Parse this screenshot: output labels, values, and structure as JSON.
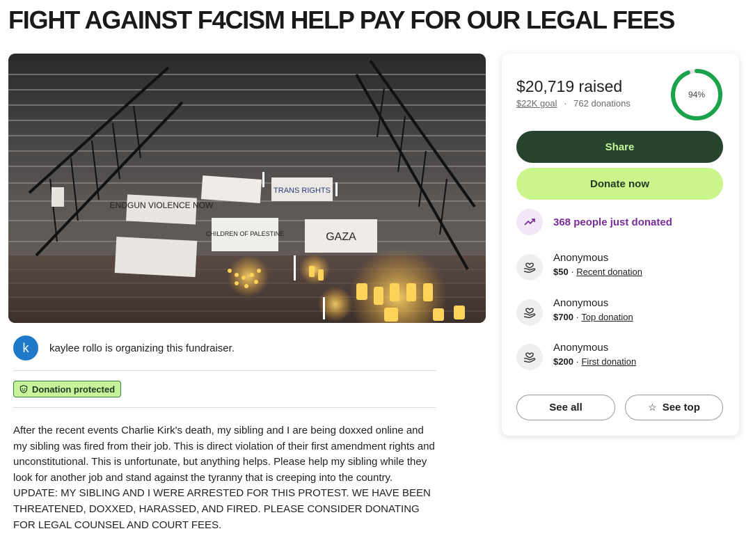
{
  "page": {
    "title": "FIGHT AGAINST F4CISM HELP PAY FOR OUR LEGAL FEES"
  },
  "photo": {
    "signs": [
      "ENDGUN VIOLENCE NOW",
      "TRANS RIGHTS",
      "CHILDREN OF PALESTINE",
      "GAZA"
    ]
  },
  "organizer": {
    "avatar_letter": "k",
    "text": "kaylee rollo is organizing this fundraiser."
  },
  "badge": {
    "label": "Donation protected"
  },
  "story": {
    "text": "After the recent events Charlie Kirk's death, my sibling and I are being doxxed online and my sibling was fired from their job. This is direct violation of their first amendment rights and unconstitutional. This is unfortunate, but anything helps. Please help my sibling while they look for another job and stand against the tyranny that is creeping into the country. UPDATE: MY SIBLING AND I WERE ARRESTED FOR THIS PROTEST. WE HAVE BEEN THREATENED, DOXXED, HARASSED, AND FIRED. PLEASE CONSIDER DONATING FOR LEGAL COUNSEL AND COURT FEES."
  },
  "donation_card": {
    "raised": "$20,719 raised",
    "goal": "$22K goal",
    "separator": "·",
    "donations_count": "762 donations",
    "progress_label": "94%",
    "progress_fraction": 0.94,
    "share_label": "Share",
    "donate_label": "Donate now",
    "just_donated": "368 people just donated",
    "donors": [
      {
        "name": "Anonymous",
        "amount": "$50",
        "sep": " · ",
        "tag": "Recent donation"
      },
      {
        "name": "Anonymous",
        "amount": "$700",
        "sep": " · ",
        "tag": "Top donation"
      },
      {
        "name": "Anonymous",
        "amount": "$200",
        "sep": " · ",
        "tag": "First donation"
      }
    ],
    "see_all_label": "See all",
    "see_top_label": "See top",
    "see_top_icon": "star-icon"
  },
  "colors": {
    "dark_green": "#27452e",
    "lime": "#c9f58a",
    "progress_green": "#1aa34a",
    "purple": "#7b2d9b",
    "avatar_blue": "#1f78c8"
  }
}
